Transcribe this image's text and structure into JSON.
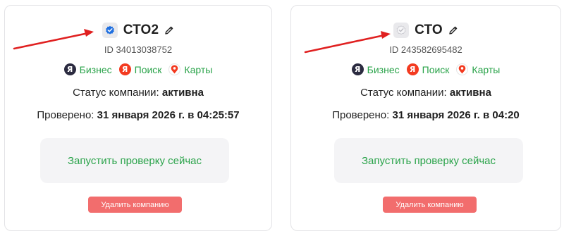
{
  "colors": {
    "accent_green": "#2aa34a",
    "verified_blue": "#1f6fe0",
    "delete_red": "#f26d6d",
    "annotation_arrow": "#e02020"
  },
  "cards": [
    {
      "name": "СТО2",
      "verified": true,
      "id_text": "ID 34013038752",
      "services": [
        {
          "label": "Бизнес",
          "icon": "yandex-business-icon"
        },
        {
          "label": "Поиск",
          "icon": "yandex-search-icon"
        },
        {
          "label": "Карты",
          "icon": "yandex-maps-icon"
        }
      ],
      "status_label": "Статус компании:",
      "status_value": "активна",
      "checked_label": "Проверено:",
      "checked_value": "31 января 2026 г. в 04:25:57",
      "run_check_label": "Запустить проверку сейчас",
      "delete_label": "Удалить компанию"
    },
    {
      "name": "СТО",
      "verified": false,
      "id_text": "ID 243582695482",
      "services": [
        {
          "label": "Бизнес",
          "icon": "yandex-business-icon"
        },
        {
          "label": "Поиск",
          "icon": "yandex-search-icon"
        },
        {
          "label": "Карты",
          "icon": "yandex-maps-icon"
        }
      ],
      "status_label": "Статус компании:",
      "status_value": "активна",
      "checked_label": "Проверено:",
      "checked_value": "31 января 2026 г. в 04:20",
      "run_check_label": "Запустить проверку сейчас",
      "delete_label": "Удалить компанию"
    }
  ]
}
